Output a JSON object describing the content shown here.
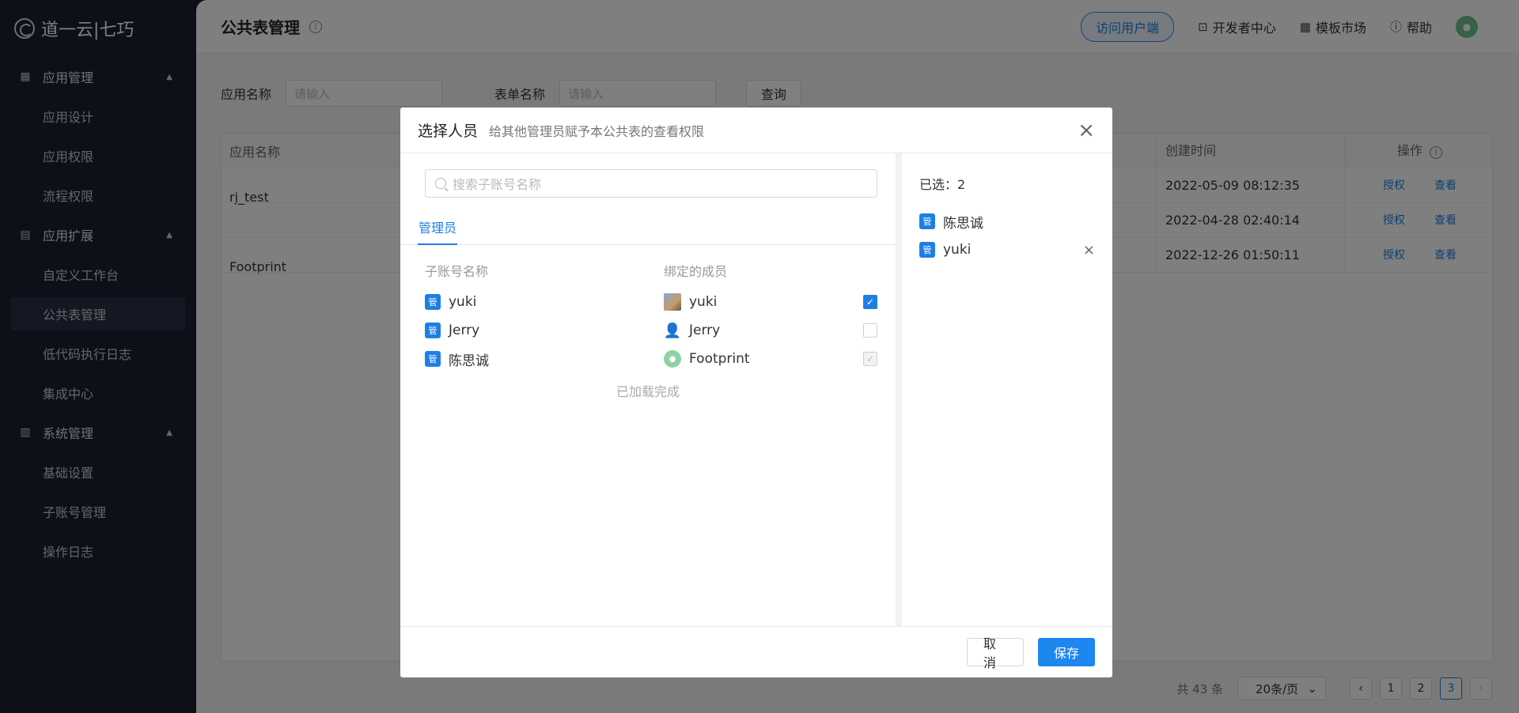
{
  "logo": {
    "text": "道一云|七巧"
  },
  "sidebar": {
    "groups": [
      {
        "label": "应用管理",
        "icon": "grid-icon",
        "items": [
          "应用设计",
          "应用权限",
          "流程权限"
        ]
      },
      {
        "label": "应用扩展",
        "icon": "document-icon",
        "items": [
          "自定义工作台",
          "公共表管理",
          "低代码执行日志",
          "集成中心"
        ]
      },
      {
        "label": "系统管理",
        "icon": "settings-panel-icon",
        "items": [
          "基础设置",
          "子账号管理",
          "操作日志"
        ]
      }
    ],
    "active_item": "公共表管理"
  },
  "topbar": {
    "title": "公共表管理",
    "visit_user": "访问用户端",
    "developer": "开发者中心",
    "templates": "模板市场",
    "help": "帮助"
  },
  "filters": {
    "app_label": "应用名称",
    "app_placeholder": "请输入",
    "form_label": "表单名称",
    "form_placeholder": "请输入",
    "query": "查询"
  },
  "table": {
    "headers": {
      "app": "应用名称",
      "time": "创建时间",
      "op": "操作"
    },
    "rows": [
      {
        "time": "2022-05-09 08:12:35"
      },
      {
        "time": "2022-04-28 02:40:14"
      },
      {
        "time": "2022-12-26 01:50:11"
      }
    ],
    "groups": [
      "rj_test",
      "Footprint"
    ],
    "op_grant": "授权",
    "op_view": "查看"
  },
  "pager": {
    "total": "共 43 条",
    "page_size": "20条/页",
    "pages": [
      "1",
      "2",
      "3"
    ],
    "current": "3"
  },
  "modal": {
    "title": "选择人员",
    "subtitle": "给其他管理员赋予本公共表的查看权限",
    "search_placeholder": "搜索子账号名称",
    "tab": "管理员",
    "col_account": "子账号名称",
    "col_member": "绑定的成员",
    "badge": "管",
    "rows": [
      {
        "account": "yuki",
        "member": "yuki",
        "avatar": "photo",
        "checked": true,
        "disabled": false
      },
      {
        "account": "Jerry",
        "member": "Jerry",
        "avatar": "person",
        "checked": false,
        "disabled": false
      },
      {
        "account": "陈思诚",
        "member": "Footprint",
        "avatar": "pig",
        "checked": true,
        "disabled": true
      }
    ],
    "loaded_text": "已加载完成",
    "selected_label": "已选：2",
    "selected": [
      "陈思诚",
      "yuki"
    ],
    "cancel": "取消",
    "save": "保存"
  }
}
